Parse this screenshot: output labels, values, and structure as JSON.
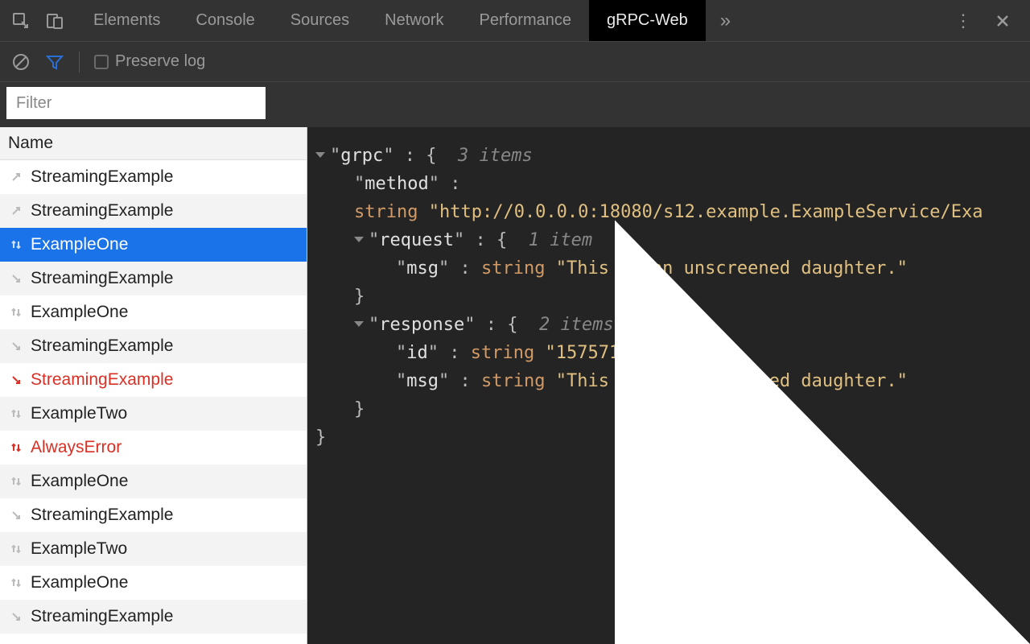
{
  "tabs": {
    "items": [
      "Elements",
      "Console",
      "Sources",
      "Network",
      "Performance",
      "gRPC-Web"
    ],
    "active": "gRPC-Web"
  },
  "toolbar": {
    "preserve_log_label": "Preserve log"
  },
  "filter": {
    "placeholder": "Filter"
  },
  "list": {
    "header": "Name",
    "items": [
      {
        "name": "StreamingExample",
        "icon": "up-arrow",
        "status": "normal"
      },
      {
        "name": "StreamingExample",
        "icon": "up-arrow",
        "status": "normal"
      },
      {
        "name": "ExampleOne",
        "icon": "updown",
        "status": "selected"
      },
      {
        "name": "StreamingExample",
        "icon": "down-arrow",
        "status": "normal"
      },
      {
        "name": "ExampleOne",
        "icon": "updown",
        "status": "normal"
      },
      {
        "name": "StreamingExample",
        "icon": "down-arrow",
        "status": "normal"
      },
      {
        "name": "StreamingExample",
        "icon": "down-arrow",
        "status": "error"
      },
      {
        "name": "ExampleTwo",
        "icon": "updown",
        "status": "normal"
      },
      {
        "name": "AlwaysError",
        "icon": "updown",
        "status": "error"
      },
      {
        "name": "ExampleOne",
        "icon": "updown",
        "status": "normal"
      },
      {
        "name": "StreamingExample",
        "icon": "down-arrow",
        "status": "normal"
      },
      {
        "name": "ExampleTwo",
        "icon": "updown",
        "status": "normal"
      },
      {
        "name": "ExampleOne",
        "icon": "updown",
        "status": "normal"
      },
      {
        "name": "StreamingExample",
        "icon": "down-arrow",
        "status": "normal"
      }
    ]
  },
  "detail": {
    "root_key": "grpc",
    "root_count": "3 items",
    "method_key": "method",
    "method_type": "string",
    "method_value": "\"http://0.0.0.0:18080/s12.example.ExampleService/Exa",
    "request_key": "request",
    "request_count": "1 item",
    "request_msg_key": "msg",
    "request_msg_type": "string",
    "request_msg_value": "\"This is an unscreened daughter.\"",
    "response_key": "response",
    "response_count": "2 items",
    "response_id_key": "id",
    "response_id_type": "string",
    "response_id_value": "\"1575714596\"",
    "response_msg_key": "msg",
    "response_msg_type": "string",
    "response_msg_value": "\"This is an unscreened daughter.\""
  }
}
